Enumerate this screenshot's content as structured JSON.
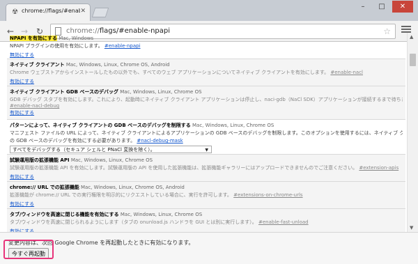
{
  "tab": {
    "title": "chrome://flags/#enable-np",
    "favicon": "flask-icon"
  },
  "toolbar": {
    "url_scheme": "chrome://",
    "url_rest": "flags/#enable-npapi"
  },
  "flags": [
    {
      "name": "NPAPI を有効にする",
      "platforms": "Mac, Windows",
      "description": "NPAPI プラグインの使用を有効にします。",
      "tag": "#enable-npapi",
      "action": "無効にする",
      "highlight": true,
      "disabled": false
    },
    {
      "name": "ネイティブ クライアント",
      "platforms": "Mac, Windows, Linux, Chrome OS, Android",
      "description": "Chrome ウェブストアからインストールしたもの以外でも、すべてのウェブ アプリケーションについてネイティブ クライアントを有効にします。",
      "tag": "#enable-nacl",
      "action": "有効にする",
      "highlight": false,
      "disabled": true
    },
    {
      "name": "ネイティブ クライアント GDB ベースのデバッグ",
      "platforms": "Mac, Windows, Linux, Chrome OS",
      "description": "GDB デバッグ スタブを有効にします。これにより、起動時にネイティブ クライアント アプリケーションは停止し、naci-gdb（NaCl SDK）アプリケーションが接続するまで待ちます。",
      "tag": "#enable-nacl-debug",
      "action": "有効にする",
      "highlight": false,
      "disabled": true
    },
    {
      "name": "パターンによって、ネイティブ クライアントの GDB ベースのデバッグを制限する",
      "platforms": "Mac, Windows, Linux, Chrome OS",
      "description": "マニフェスト ファイルの URL によって、ネイティブ クライアントによるアプリケーションの GDB ベースのデバッグを制限します。このオプションを使用するには、ネイティブ クライアント",
      "description2": "の GDB ベースのデバッグを有効にする必要があります。",
      "tag": "#nacl-debug-mask",
      "select_value": "すべてをデバッグする（セキュア シェルと PNaCl 変換を除く）。",
      "highlight": false,
      "disabled": false
    },
    {
      "name": "試験運用版の拡張機能 API",
      "platforms": "Mac, Windows, Linux, Chrome OS",
      "description": "試験運用版の拡張機能 API を有効にします。試験運用版の API を使用した拡張機能は、拡張機能ギャラリーにはアップロードできませんのでご注意ください。",
      "tag": "#extension-apis",
      "action": "有効にする",
      "highlight": false,
      "disabled": true
    },
    {
      "name": "chrome:// URL での拡張機能",
      "platforms": "Mac, Windows, Linux, Chrome OS, Android",
      "description": "拡張機能が chrome:// URL での実行権限を明示的にリクエストしている場合に、実行を許可します。",
      "tag": "#extensions-on-chrome-urls",
      "action": "有効にする",
      "highlight": false,
      "disabled": true
    },
    {
      "name": "タブ/ウィンドウを高速に閉じる機能を有効にする",
      "platforms": "Mac, Windows, Linux, Chrome OS",
      "description": "タブ/ウィンドウを高速に閉じられるようにします（タブの onunload.js ハンドラを GUI とは別に実行します）。",
      "tag": "#enable-fast-unload",
      "action": "有効にする",
      "highlight": false,
      "disabled": true
    }
  ],
  "bottom": {
    "message": "変更内容は、次回 Google Chrome を再起動したときに有効になります。",
    "restart_label": "今すぐ再起動"
  },
  "window": {
    "min": "–",
    "max": "□",
    "close": "✕"
  }
}
